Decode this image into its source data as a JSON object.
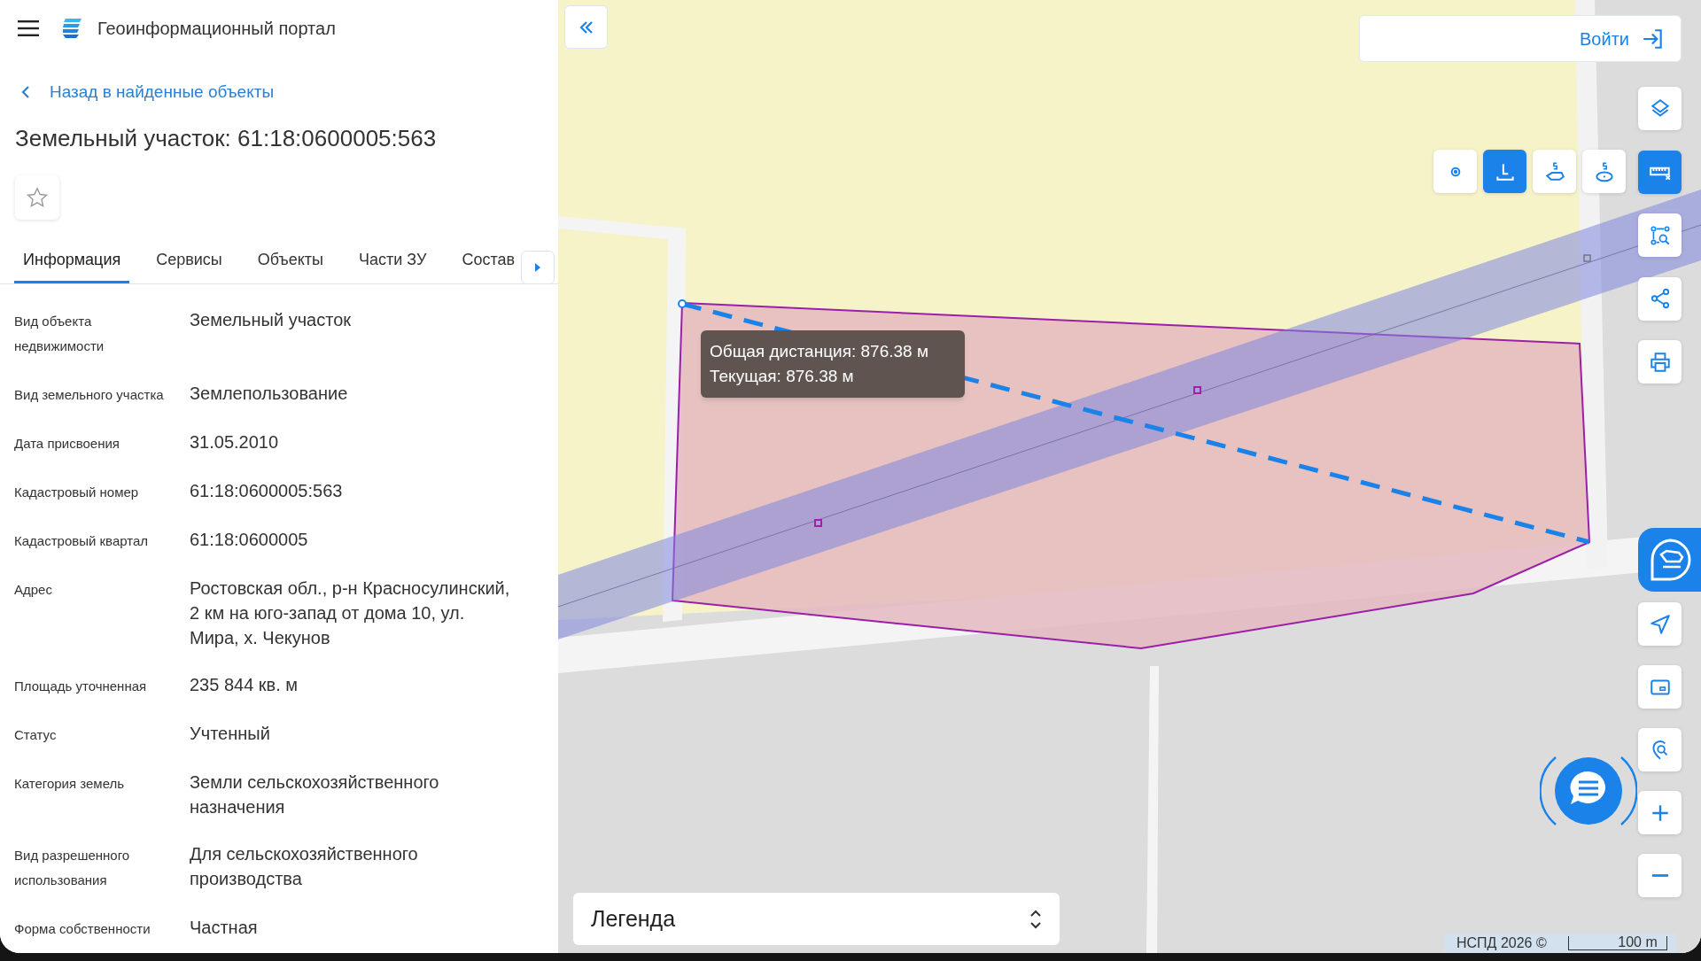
{
  "header": {
    "title": "Геоинформационный портал"
  },
  "back_link": "Назад в найденные объекты",
  "object_title": "Земельный участок: 61:18:0600005:563",
  "favorite": {
    "on": false
  },
  "tabs": [
    {
      "label": "Информация",
      "selected": true
    },
    {
      "label": "Сервисы",
      "selected": false
    },
    {
      "label": "Объекты",
      "selected": false
    },
    {
      "label": "Части ЗУ",
      "selected": false
    },
    {
      "label": "Состав",
      "selected": false
    }
  ],
  "properties": [
    {
      "label": "Вид объекта недвижимости",
      "value": "Земельный участок"
    },
    {
      "label": "Вид земельного участка",
      "value": "Землепользование"
    },
    {
      "label": "Дата присвоения",
      "value": "31.05.2010"
    },
    {
      "label": "Кадастровый номер",
      "value": "61:18:0600005:563"
    },
    {
      "label": "Кадастровый квартал",
      "value": "61:18:0600005"
    },
    {
      "label": "Адрес",
      "value": "Ростовская обл., р-н Красносулинский, 2 км на юго-запад от дома 10, ул. Мира, х. Чекунов"
    },
    {
      "label": "Площадь уточненная",
      "value": "235 844 кв. м"
    },
    {
      "label": "Статус",
      "value": "Учтенный"
    },
    {
      "label": "Категория земель",
      "value": "Земли сельскохозяйственного назначения"
    },
    {
      "label": "Вид разрешенного использования",
      "value": "Для сельскохозяйственного производства"
    },
    {
      "label": "Форма собственности",
      "value": "Частная"
    }
  ],
  "login": {
    "label": "Войти"
  },
  "measure_tools": [
    {
      "kind": "point",
      "selected": false
    },
    {
      "kind": "length",
      "selected": true
    },
    {
      "kind": "polygon-area",
      "selected": false
    },
    {
      "kind": "circle-area",
      "selected": false
    }
  ],
  "side_tools": [
    {
      "kind": "layers",
      "selected": false
    },
    {
      "kind": "ruler",
      "selected": true
    },
    {
      "kind": "select-area",
      "selected": false
    },
    {
      "kind": "share",
      "selected": false
    },
    {
      "kind": "print",
      "selected": false
    }
  ],
  "bottom_tools": [
    {
      "kind": "navigate"
    },
    {
      "kind": "minimap"
    },
    {
      "kind": "search-location"
    },
    {
      "kind": "zoom-in"
    },
    {
      "kind": "zoom-out"
    }
  ],
  "tooltip": {
    "lines": [
      "Общая дистанция: 876.38 м",
      "Текущая: 876.38 м"
    ]
  },
  "legend": {
    "label": "Легенда"
  },
  "attribution": "НСПД 2026 ©",
  "scale": "100 m"
}
